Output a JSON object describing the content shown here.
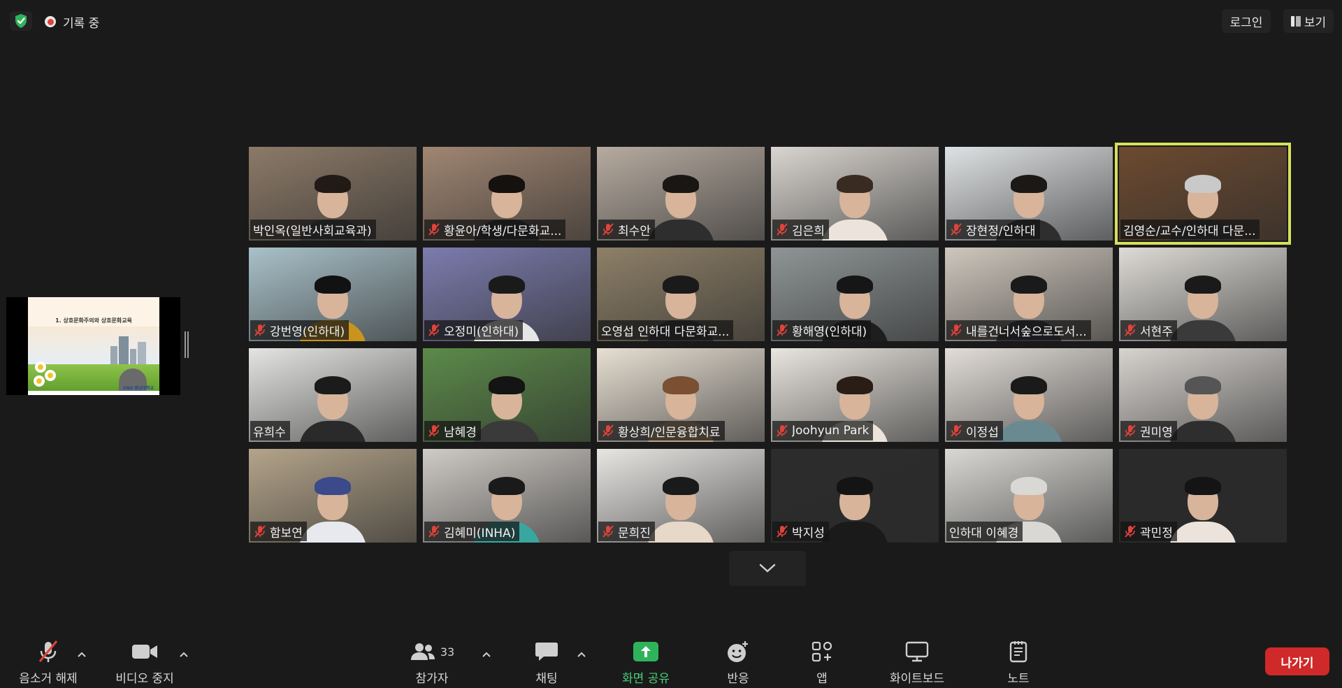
{
  "topbar": {
    "recording_label": "기록 중",
    "login_label": "로그인",
    "view_label": "보기"
  },
  "shared_screen": {
    "slide_title": "1. 상호문화주의와 상호문화교육",
    "slide_logo": "CNU 충남대학교"
  },
  "participants": [
    {
      "name": "박인옥(일반사회교육과)",
      "muted": false,
      "bg": "#8c7a68",
      "body": "#3c3c3c",
      "hair": "#221a16"
    },
    {
      "name": "황윤아/학생/다문화교...",
      "muted": true,
      "bg": "#a08672",
      "body": "#262626",
      "hair": "#15110f"
    },
    {
      "name": "최수안",
      "muted": true,
      "bg": "#b6aba0",
      "body": "#2e2e2e",
      "hair": "#1a1614"
    },
    {
      "name": "김은희",
      "muted": true,
      "bg": "#d9d5d0",
      "body": "#ece4dc",
      "hair": "#3a2b22"
    },
    {
      "name": "장현정/인하대",
      "muted": true,
      "bg": "#dfe2e4",
      "body": "#2e2e2e",
      "hair": "#1c1816"
    },
    {
      "name": "김영순/교수/인하대 다문...",
      "muted": false,
      "bg": "#6c4a30",
      "body": "#2f2f33",
      "hair": "#c9c9c9"
    },
    {
      "name": "강번영(인하대)",
      "muted": true,
      "bg": "#a9c1c9",
      "body": "#c9941e",
      "hair": "#121212"
    },
    {
      "name": "오정미(인하대)",
      "muted": true,
      "bg": "#7c7cae",
      "body": "#e6e6e6",
      "hair": "#1a1a1a"
    },
    {
      "name": "오영섭 인하대 다문화교...",
      "muted": false,
      "bg": "#8e8068",
      "body": "#2c2c30",
      "hair": "#1a1a1a"
    },
    {
      "name": "황해영(인하대)",
      "muted": true,
      "bg": "#8f9596",
      "body": "#1e1e1e",
      "hair": "#161616"
    },
    {
      "name": "내를건너서숲으로도서...",
      "muted": true,
      "bg": "#cfc7bd",
      "body": "#2f3038",
      "hair": "#1a1a1a"
    },
    {
      "name": "서현주",
      "muted": true,
      "bg": "#dedbd6",
      "body": "#3a3a3a",
      "hair": "#1a1a1a"
    },
    {
      "name": "유희수",
      "muted": false,
      "bg": "#e4e4e2",
      "body": "#2a2a2a",
      "hair": "#1b1b1b"
    },
    {
      "name": "남혜경",
      "muted": true,
      "bg": "#5c8a4a",
      "body": "#3a3a3a",
      "hair": "#141414"
    },
    {
      "name": "황상희/인문융합치료",
      "muted": true,
      "bg": "#e7dfd2",
      "body": "#c0a37e",
      "hair": "#7a4f32"
    },
    {
      "name": "Joohyun Park",
      "muted": true,
      "bg": "#e9e5df",
      "body": "#ece4dc",
      "hair": "#2a1d15"
    },
    {
      "name": "이정섭",
      "muted": true,
      "bg": "#e2ddd8",
      "body": "#6a8a92",
      "hair": "#1a1a1a"
    },
    {
      "name": "권미영",
      "muted": true,
      "bg": "#d7d3cf",
      "body": "#2e2e2e",
      "hair": "#555555"
    },
    {
      "name": "함보연",
      "muted": true,
      "bg": "#b4a48a",
      "body": "#e7e9ee",
      "hair": "#3a4a8a"
    },
    {
      "name": "김혜미(INHA)",
      "muted": true,
      "bg": "#cfcbc6",
      "body": "#3aa6a0",
      "hair": "#1a1a1a"
    },
    {
      "name": "문희진",
      "muted": true,
      "bg": "#e8e6e3",
      "body": "#e8d8c8",
      "hair": "#1a1a1a"
    },
    {
      "name": "박지성",
      "muted": true,
      "bg": "#2c2c2c",
      "body": "#1a1a1a",
      "hair": "#141414"
    },
    {
      "name": "인하대 이혜경",
      "muted": false,
      "bg": "#d9d8d4",
      "body": "#d9d8d4",
      "hair": "#d9d8d4"
    },
    {
      "name": "곽민정",
      "muted": true,
      "bg": "#2a2a2a",
      "body": "#ece4dc",
      "hair": "#141414"
    }
  ],
  "toolbar": {
    "audio_label": "음소거 해제",
    "video_label": "비디오 중지",
    "participants_label": "참가자",
    "participants_count": "33",
    "chat_label": "채팅",
    "share_label": "화면 공유",
    "reactions_label": "반응",
    "apps_label": "앱",
    "whiteboard_label": "화이트보드",
    "notes_label": "노트",
    "leave_label": "나가기"
  },
  "colors": {
    "background": "#1a1a1a",
    "active_speaker": "#d6e05a",
    "share_green": "#4ad07a",
    "leave_red": "#cf2929",
    "muted_red": "#e0433a"
  }
}
